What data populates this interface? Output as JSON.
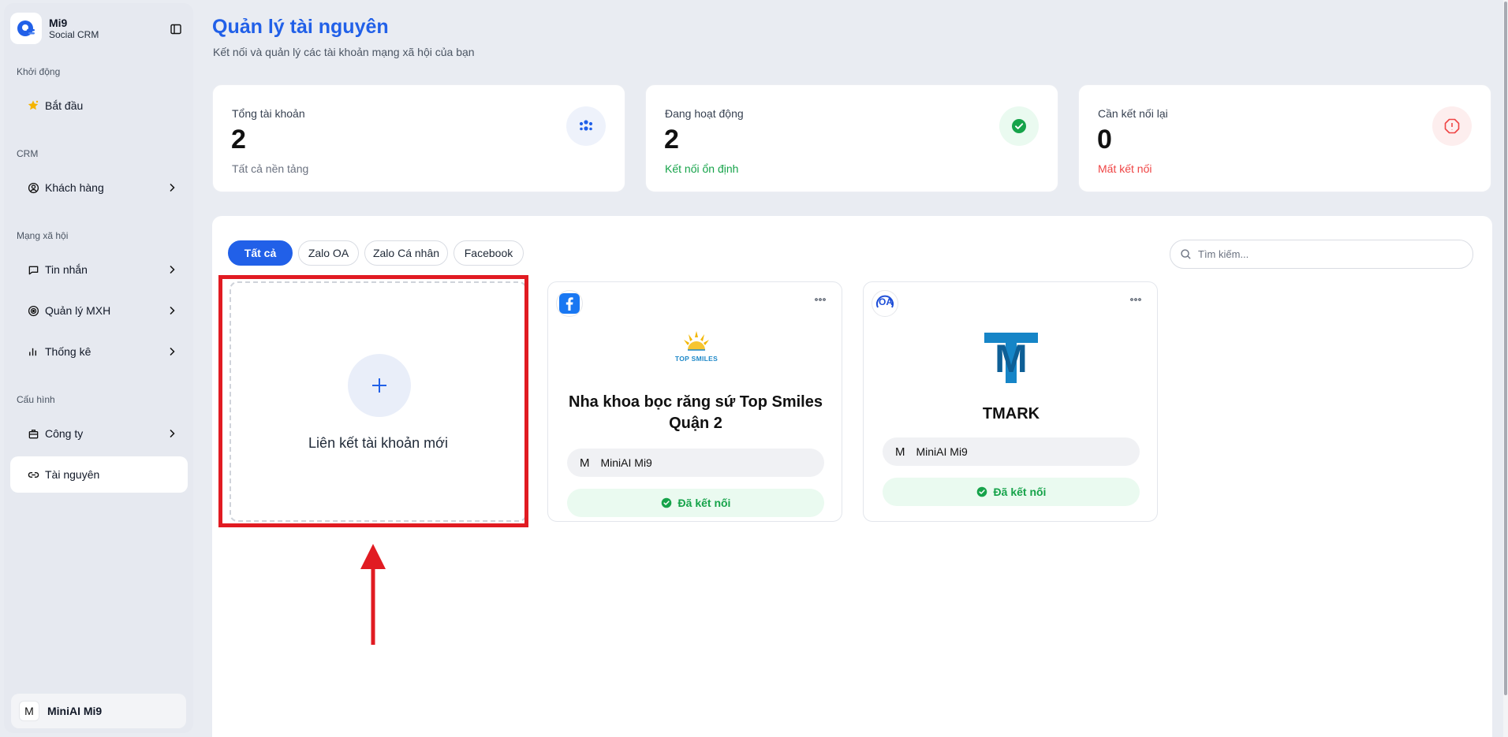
{
  "brand": {
    "name": "Mi9",
    "subtitle": "Social CRM",
    "accent": "#2160e8"
  },
  "sidebar": {
    "sections": [
      {
        "label": "Khởi động"
      },
      {
        "label": "CRM"
      },
      {
        "label": "Mạng xã hội"
      },
      {
        "label": "Cấu hình"
      }
    ],
    "items": [
      {
        "label": "Bắt đầu",
        "icon": "sparkle-star-icon"
      },
      {
        "label": "Khách hàng",
        "icon": "user-circle-icon",
        "expandable": true
      },
      {
        "label": "Tin nhắn",
        "icon": "message-icon",
        "expandable": true
      },
      {
        "label": "Quản lý MXH",
        "icon": "orbit-icon",
        "expandable": true
      },
      {
        "label": "Thống kê",
        "icon": "bar-chart-icon",
        "expandable": true
      },
      {
        "label": "Công ty",
        "icon": "building-icon",
        "expandable": true
      },
      {
        "label": "Tài nguyên",
        "icon": "link-icon",
        "active": true
      }
    ],
    "user": {
      "initial": "M",
      "name": "MiniAI Mi9"
    }
  },
  "header": {
    "title": "Quản lý tài nguyên",
    "subtitle": "Kết nối và quản lý các tài khoản mạng xã hội của bạn"
  },
  "stats": [
    {
      "label": "Tổng tài khoản",
      "value": "2",
      "note": "Tất cả nền tảng",
      "note_color": "#6b7280",
      "icon": "users-icon"
    },
    {
      "label": "Đang hoạt động",
      "value": "2",
      "note": "Kết nối ổn định",
      "note_color": "#16a34a",
      "icon": "check-circle-icon"
    },
    {
      "label": "Cần kết nối lại",
      "value": "0",
      "note": "Mất kết nối",
      "note_color": "#ef4444",
      "icon": "alert-octagon-icon"
    }
  ],
  "filters": {
    "tabs": [
      {
        "label": "Tất cả",
        "active": true
      },
      {
        "label": "Zalo OA"
      },
      {
        "label": "Zalo Cá nhân"
      },
      {
        "label": "Facebook"
      }
    ],
    "search_placeholder": "Tìm kiếm..."
  },
  "add_card": {
    "label": "Liên kết tài khoản mới"
  },
  "accounts": [
    {
      "platform": "facebook-icon",
      "logo_text": "TOP SMILES",
      "name": "Nha khoa bọc răng sứ Top Smiles Quận 2",
      "owner_initial": "M",
      "owner": "MiniAI Mi9",
      "status": "Đã kết nối"
    },
    {
      "platform": "zalo-oa-icon",
      "badge_text": "OA",
      "logo_text": "M",
      "name": "TMARK",
      "owner_initial": "M",
      "owner": "MiniAI Mi9",
      "status": "Đã kết nối"
    }
  ]
}
